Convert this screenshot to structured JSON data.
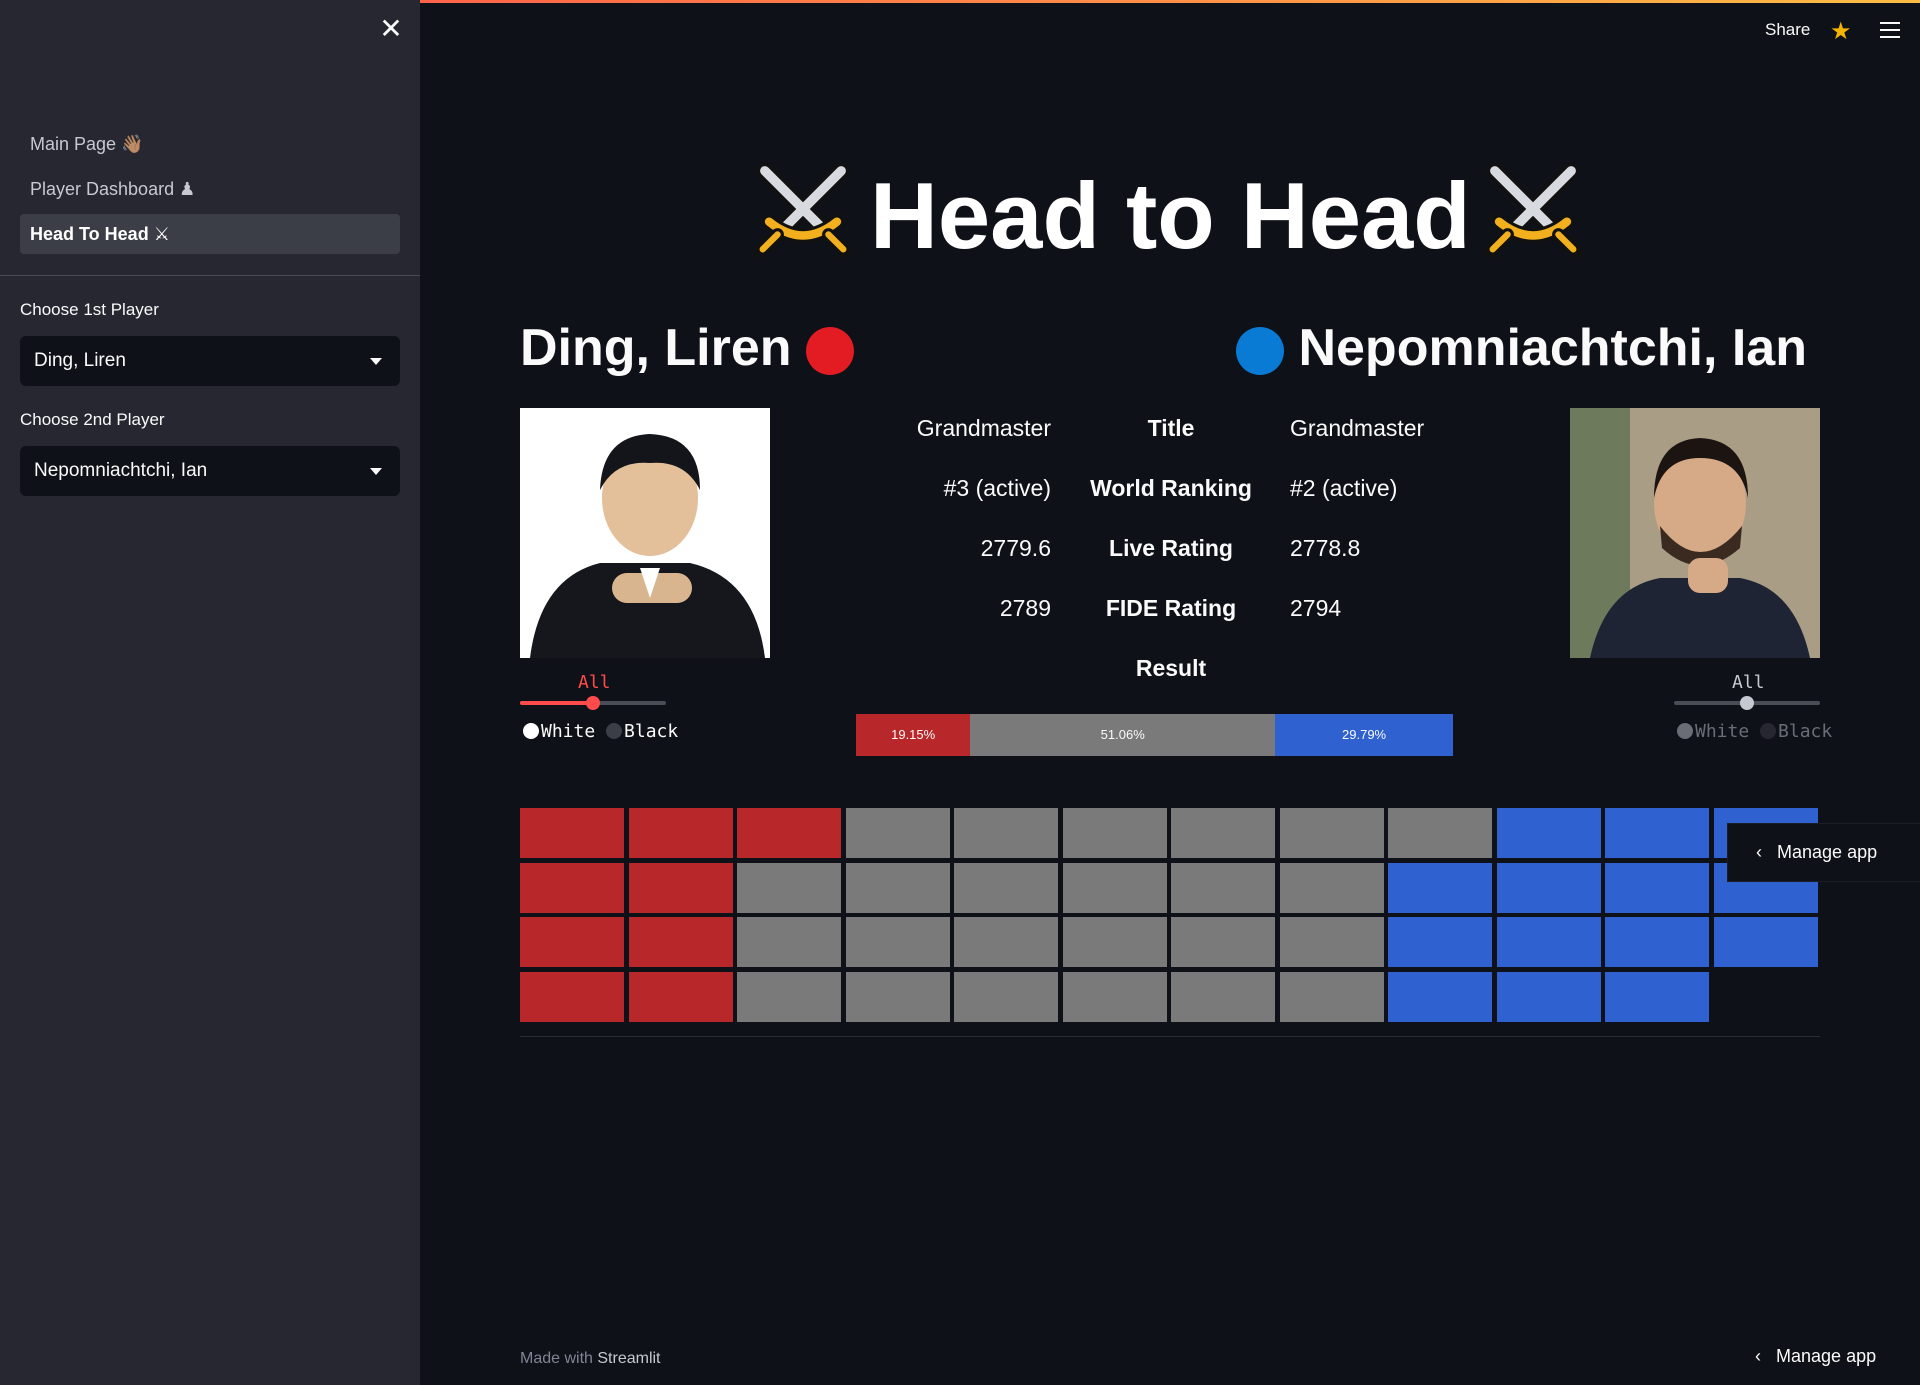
{
  "sidebar": {
    "nav": [
      {
        "label": "Main Page",
        "emoji": "👋🏽",
        "active": false
      },
      {
        "label": "Player Dashboard",
        "emoji": "♟",
        "active": false
      },
      {
        "label": "Head To Head",
        "emoji": "⚔",
        "active": true
      }
    ],
    "player1_label": "Choose 1st Player",
    "player1_value": "Ding, Liren",
    "player2_label": "Choose 2nd Player",
    "player2_value": "Nepomniachtchi, Ian"
  },
  "header": {
    "share_label": "Share"
  },
  "title": "Head to Head",
  "player1": {
    "name": "Ding, Liren",
    "color": "#e31b23",
    "title": "Grandmaster",
    "ranking": "#3 (active)",
    "live": "2779.6",
    "fide": "2789",
    "slider_label": "All",
    "radio": [
      "White",
      "Black"
    ]
  },
  "player2": {
    "name": "Nepomniachtchi, Ian",
    "color": "#0a7bd4",
    "title": "Grandmaster",
    "ranking": "#2 (active)",
    "live": "2778.8",
    "fide": "2794",
    "slider_label": "All",
    "radio": [
      "White",
      "Black"
    ]
  },
  "stats_labels": {
    "title": "Title",
    "ranking": "World Ranking",
    "live": "Live Rating",
    "fide": "FIDE Rating",
    "result": "Result"
  },
  "result": {
    "segments": [
      {
        "label": "19.15%",
        "pct": 19.15,
        "color": "#b8282b"
      },
      {
        "label": "51.06%",
        "pct": 51.06,
        "color": "#7a7a7a"
      },
      {
        "label": "29.79%",
        "pct": 29.79,
        "color": "#2f62d0"
      }
    ]
  },
  "waffle": {
    "wins": 9,
    "draws": 24,
    "losses": 14,
    "colors": {
      "wins": "#b8282b",
      "draws": "#7a7a7a",
      "losses": "#2f62d0"
    }
  },
  "manage_label": "Manage app",
  "footer": {
    "made_with": "Made with",
    "brand": "Streamlit"
  }
}
